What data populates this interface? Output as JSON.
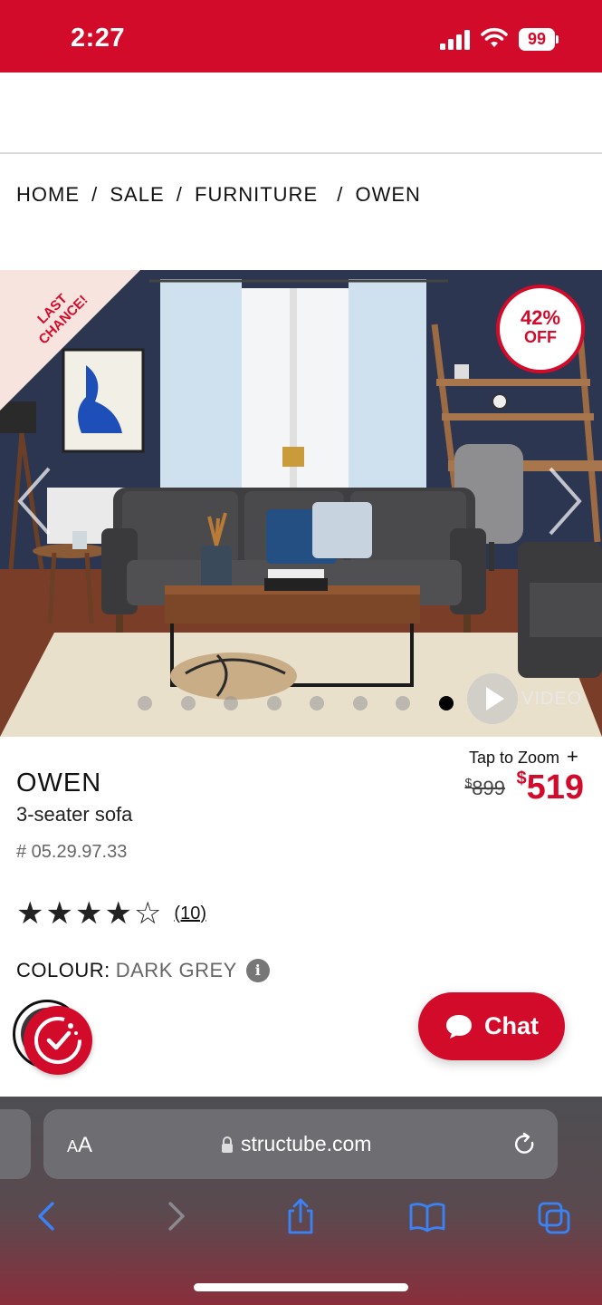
{
  "status_bar": {
    "time": "2:27",
    "battery": "99"
  },
  "breadcrumb": [
    "HOME",
    "SALE",
    "FURNITURE",
    "OWEN"
  ],
  "breadcrumb_separator": "/",
  "hero": {
    "ribbon_text": "LAST CHANCE!",
    "discount_pct": "42%",
    "discount_off": "OFF",
    "video_label": "VIDEO",
    "carousel": {
      "total": 8,
      "active": 8
    }
  },
  "product": {
    "zoom_hint": "Tap to Zoom",
    "zoom_plus": "+",
    "old_price_currency": "$",
    "old_price": "899",
    "new_price_currency": "$",
    "new_price": "519",
    "name": "OWEN",
    "subtitle": "3-seater sofa",
    "sku": "# 05.29.97.33",
    "rating": 4,
    "rating_max": 5,
    "review_count": "(10)",
    "colour_label": "COLOUR:",
    "colour_value": "DARK GREY",
    "info_glyph": "i"
  },
  "chat": {
    "label": "Chat"
  },
  "browser": {
    "aa_small": "A",
    "aa_large": "A",
    "url": "structube.com"
  },
  "colors": {
    "brand_red": "#d30b2b",
    "ios_blue": "#3a82f7"
  }
}
